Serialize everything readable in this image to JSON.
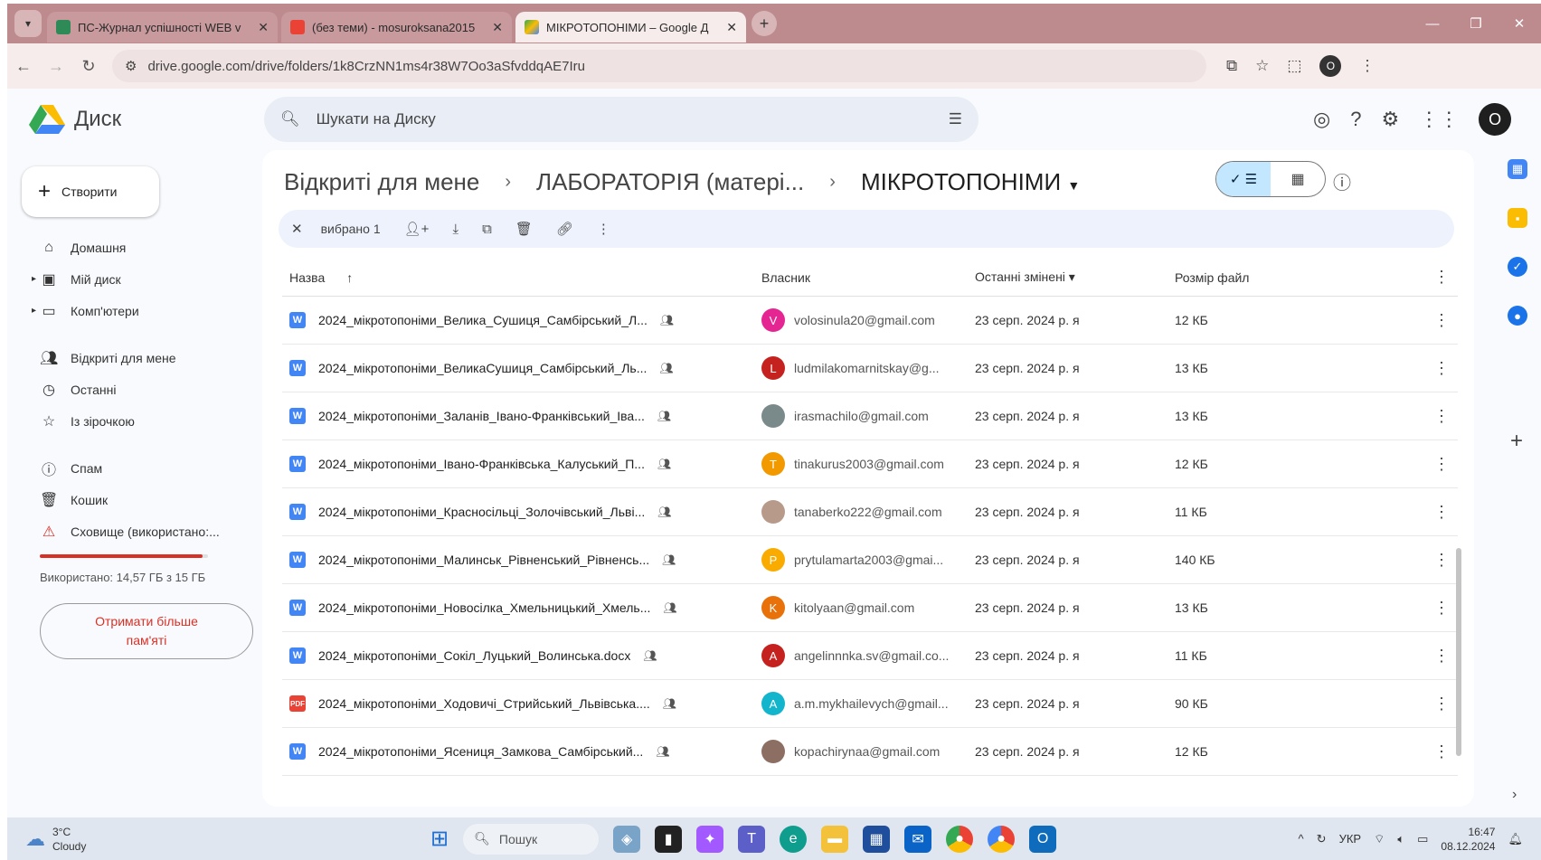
{
  "browser": {
    "tabs": [
      {
        "title": "ПС-Журнал успішності WEB v",
        "favicon_color": "#2e8b57",
        "active": false
      },
      {
        "title": "(без теми) - mosuroksana2015",
        "favicon_color": "#ea4335",
        "active": false
      },
      {
        "title": "МІКРОТОПОНІМИ – Google Д",
        "favicon_color": "#fbbc04",
        "active": true
      }
    ],
    "new_tab": "+",
    "url": "drive.google.com/drive/folders/1k8CrzNN1ms4r38W7Oo3aSfvddqAE7Iru",
    "profile_initial": "O"
  },
  "drive": {
    "app_name": "Диск",
    "search_placeholder": "Шукати на Диску",
    "avatar_initial": "O"
  },
  "sidebar": {
    "create_label": "Створити",
    "items": [
      {
        "label": "Домашня",
        "icon": "home-icon"
      },
      {
        "label": "Мій диск",
        "icon": "my-drive-icon"
      },
      {
        "label": "Комп'ютери",
        "icon": "computers-icon"
      },
      {
        "label": "Відкриті для мене",
        "icon": "shared-icon"
      },
      {
        "label": "Останні",
        "icon": "clock-icon"
      },
      {
        "label": "Із зірочкою",
        "icon": "star-icon"
      },
      {
        "label": "Спам",
        "icon": "spam-icon"
      },
      {
        "label": "Кошик",
        "icon": "trash-icon"
      },
      {
        "label": "Сховище (використано:...",
        "icon": "warning-icon"
      }
    ],
    "storage_used_fraction": 0.97,
    "storage_text": "Використано: 14,57 ГБ з 15 ГБ",
    "get_more_storage": "Отримати більше пам'яті"
  },
  "breadcrumb": {
    "root": "Відкриті для мене",
    "parent": "ЛАБОРАТОРІЯ (матері...",
    "current": "МІКРОТОПОНІМИ"
  },
  "selection_bar": {
    "count_label": "вибрано 1"
  },
  "table": {
    "headers": {
      "name": "Назва",
      "owner": "Власник",
      "modified": "Останні змінені",
      "size": "Розмір файл"
    },
    "rows": [
      {
        "type": "doc",
        "name": "2024_мікротопоніми_Велика_Сушиця_Самбірський_Л...",
        "owner_initial": "V",
        "owner_color": "#e52592",
        "owner_email": "volosinula20@gmail.com",
        "modified": "23 серп. 2024 р. я",
        "size": "12 КБ"
      },
      {
        "type": "doc",
        "name": "2024_мікротопоніми_ВеликаСушиця_Самбірський_Ль...",
        "owner_initial": "L",
        "owner_color": "#c5221f",
        "owner_email": "ludmilakomarnitskay@g...",
        "modified": "23 серп. 2024 р. я",
        "size": "13 КБ"
      },
      {
        "type": "doc",
        "name": "2024_мікротопоніми_Заланів_Івано-Франківський_Іва...",
        "owner_initial": "",
        "owner_color": "#7a8a8a",
        "owner_email": "irasmachilo@gmail.com",
        "modified": "23 серп. 2024 р. я",
        "size": "13 КБ"
      },
      {
        "type": "doc",
        "name": "2024_мікротопоніми_Івано-Франківська_Калуський_П...",
        "owner_initial": "T",
        "owner_color": "#f29900",
        "owner_email": "tinakurus2003@gmail.com",
        "modified": "23 серп. 2024 р. я",
        "size": "12 КБ"
      },
      {
        "type": "doc",
        "name": "2024_мікротопоніми_Красносільці_Золочівський_Льві...",
        "owner_initial": "",
        "owner_color": "#b89a8a",
        "owner_email": "tanaberko222@gmail.com",
        "modified": "23 серп. 2024 р. я",
        "size": "11 КБ"
      },
      {
        "type": "doc",
        "name": "2024_мікротопоніми_Малинськ_Рівненський_Рівненсь...",
        "owner_initial": "P",
        "owner_color": "#f9ab00",
        "owner_email": "prytulamarta2003@gmai...",
        "modified": "23 серп. 2024 р. я",
        "size": "140 КБ"
      },
      {
        "type": "doc",
        "name": "2024_мікротопоніми_Новосілка_Хмельницький_Хмель...",
        "owner_initial": "K",
        "owner_color": "#e8710a",
        "owner_email": "kitolyaan@gmail.com",
        "modified": "23 серп. 2024 р. я",
        "size": "13 КБ"
      },
      {
        "type": "doc",
        "name": "2024_мікротопоніми_Сокіл_Луцький_Волинська.docx",
        "owner_initial": "A",
        "owner_color": "#c5221f",
        "owner_email": "angelinnnka.sv@gmail.co...",
        "modified": "23 серп. 2024 р. я",
        "size": "11 КБ"
      },
      {
        "type": "pdf",
        "name": "2024_мікротопоніми_Ходовичі_Стрийський_Львівська....",
        "owner_initial": "A",
        "owner_color": "#12b5cb",
        "owner_email": "a.m.mykhailevych@gmail...",
        "modified": "23 серп. 2024 р. я",
        "size": "90 КБ"
      },
      {
        "type": "doc",
        "name": "2024_мікротопоніми_Ясениця_Замкова_Самбірський...",
        "owner_initial": "",
        "owner_color": "#8d6e63",
        "owner_email": "kopachirynaa@gmail.com",
        "modified": "23 серп. 2024 р. я",
        "size": "12 КБ"
      }
    ]
  },
  "taskbar": {
    "temperature": "3°C",
    "weather": "Cloudy",
    "search_label": "Пошук",
    "lang": "УКР",
    "time": "16:47",
    "date": "08.12.2024"
  }
}
